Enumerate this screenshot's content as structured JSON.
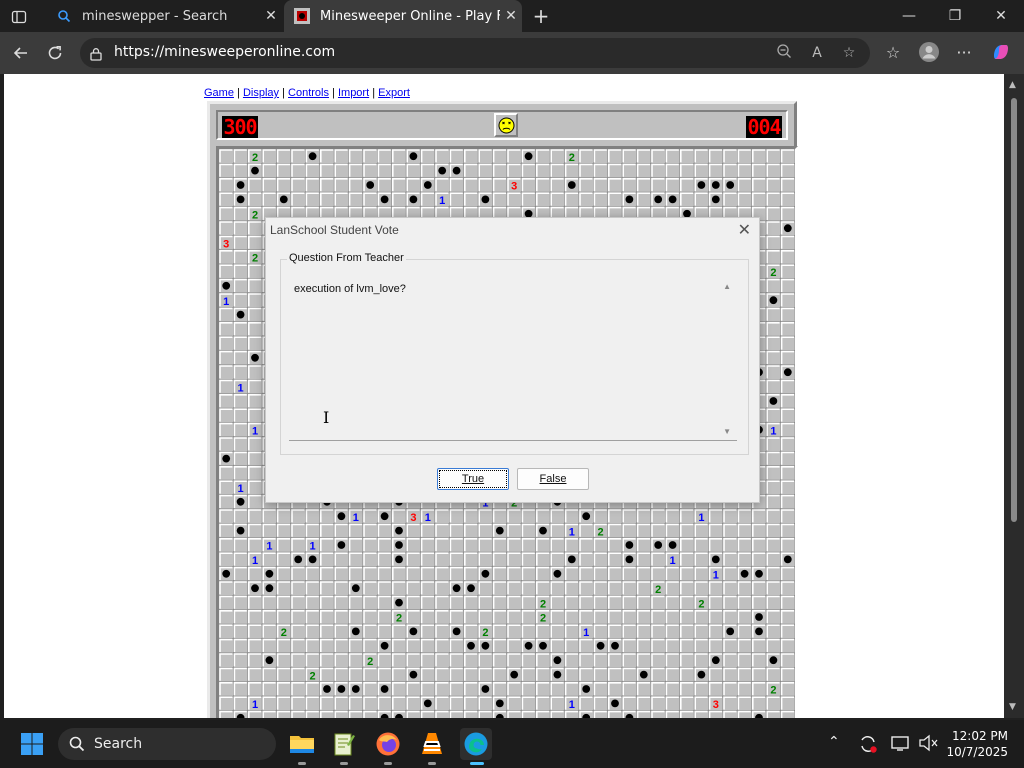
{
  "browser": {
    "tabs": [
      {
        "title": "mineswepper - Search",
        "favicon": "search-icon",
        "active": false
      },
      {
        "title": "Minesweeper Online - Play Free O",
        "favicon": "minesweeper-icon",
        "active": true
      }
    ],
    "new_tab": "+",
    "url": "https://minesweeperonline.com",
    "controls": {
      "minimize": "—",
      "restore": "❐",
      "close": "✕"
    }
  },
  "page": {
    "menu": {
      "game": "Game",
      "display": "Display",
      "controls": "Controls",
      "import": "Import",
      "export": "Export",
      "separator": " | "
    },
    "mines_left": "300",
    "timer": "004",
    "face": "dead-face-icon",
    "board": {
      "cols": 40,
      "rows": 40,
      "visible_rows": 40,
      "colors": {
        "tile": "#c0c0c0",
        "light": "#ffffff",
        "dark": "#808080",
        "one": "#0000ff",
        "two": "#008000",
        "three": "#ff0000"
      }
    }
  },
  "dialog": {
    "title": "LanSchool Student Vote",
    "close": "✕",
    "group_label": "Question From Teacher",
    "question": "execution of lvm_love?",
    "true_label": "True",
    "false_label": "False"
  },
  "taskbar": {
    "search_label": "Search",
    "time": "12:02 PM",
    "date": "10/7/2025",
    "accent": "#4cc2ff"
  }
}
